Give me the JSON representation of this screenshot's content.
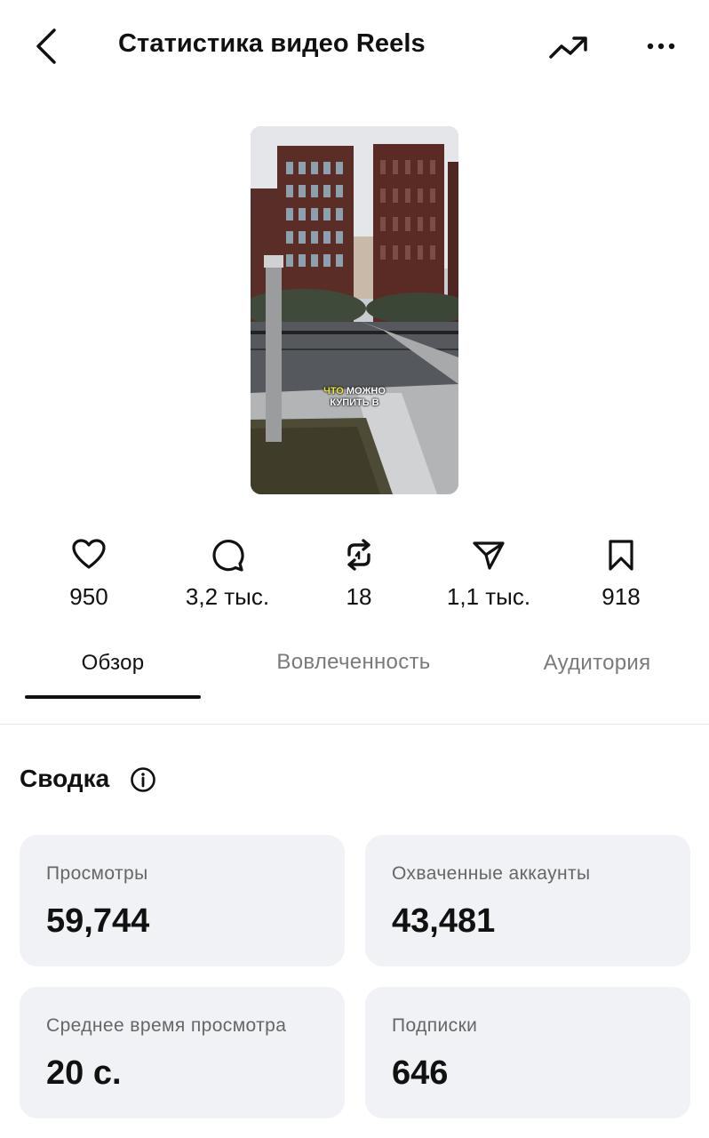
{
  "header": {
    "title": "Статистика видео Reels",
    "back_icon": "chevron-left-icon",
    "trend_icon": "trending-up-icon",
    "more_icon": "more-horizontal-icon"
  },
  "thumbnail": {
    "caption_highlight": "ЧТО",
    "caption_line1_rest": " МОЖНО",
    "caption_line2": "КУПИТЬ В"
  },
  "stats": [
    {
      "icon": "heart-icon",
      "value": "950"
    },
    {
      "icon": "comment-icon",
      "value": "3,2 тыс."
    },
    {
      "icon": "repost-icon",
      "value": "18"
    },
    {
      "icon": "share-icon",
      "value": "1,1 тыс."
    },
    {
      "icon": "bookmark-icon",
      "value": "918"
    }
  ],
  "tabs": [
    {
      "label": "Обзор",
      "active": true
    },
    {
      "label": "Вовлеченность",
      "active": false
    },
    {
      "label": "Аудитория",
      "active": false
    }
  ],
  "summary": {
    "title": "Сводка",
    "info_icon": "info-icon",
    "cards": [
      {
        "label": "Просмотры",
        "value": "59,744"
      },
      {
        "label": "Охваченные аккаунты",
        "value": "43,481"
      },
      {
        "label": "Среднее время просмотра",
        "value": "20 с."
      },
      {
        "label": "Подписки",
        "value": "646"
      }
    ]
  },
  "colors": {
    "background": "#ffffff",
    "card_background": "#f0f2f5",
    "text_primary": "#111111",
    "text_secondary": "#666666",
    "tab_inactive": "#7a7a7a",
    "caption_highlight": "#f2e83a"
  }
}
